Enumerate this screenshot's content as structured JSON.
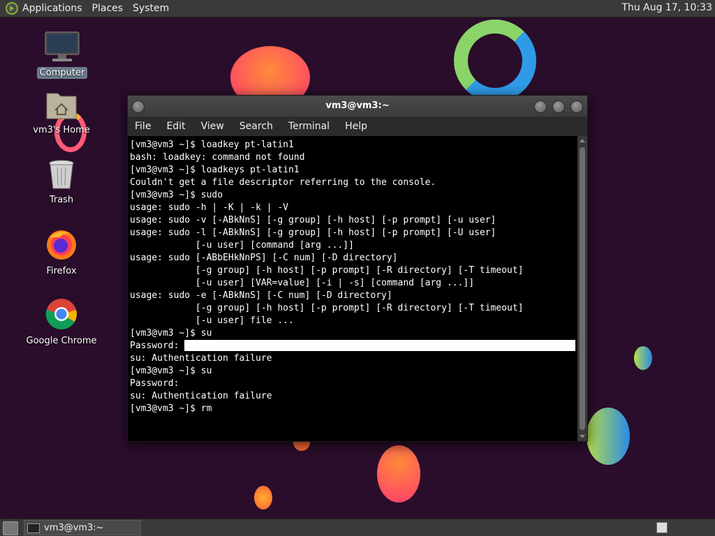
{
  "top_panel": {
    "menus": [
      "Applications",
      "Places",
      "System"
    ],
    "clock": "Thu Aug 17, 10:33"
  },
  "desktop_icons": [
    {
      "label": "Computer",
      "icon": "computer-icon"
    },
    {
      "label": "vm3's Home",
      "icon": "home-folder-icon"
    },
    {
      "label": "Trash",
      "icon": "trash-icon"
    },
    {
      "label": "Firefox",
      "icon": "firefox-icon"
    },
    {
      "label": "Google Chrome",
      "icon": "chrome-icon"
    }
  ],
  "window": {
    "title": "vm3@vm3:~",
    "menus": [
      "File",
      "Edit",
      "View",
      "Search",
      "Terminal",
      "Help"
    ]
  },
  "terminal": {
    "lines_before_password": "[vm3@vm3 ~]$ loadkey pt-latin1\nbash: loadkey: command not found\n[vm3@vm3 ~]$ loadkeys pt-latin1\nCouldn't get a file descriptor referring to the console.\n[vm3@vm3 ~]$ sudo\nusage: sudo -h | -K | -k | -V\nusage: sudo -v [-ABkNnS] [-g group] [-h host] [-p prompt] [-u user]\nusage: sudo -l [-ABkNnS] [-g group] [-h host] [-p prompt] [-U user]\n            [-u user] [command [arg ...]]\nusage: sudo [-ABbEHkNnPS] [-C num] [-D directory]\n            [-g group] [-h host] [-p prompt] [-R directory] [-T timeout]\n            [-u user] [VAR=value] [-i | -s] [command [arg ...]]\nusage: sudo -e [-ABkNnS] [-C num] [-D directory]\n            [-g group] [-h host] [-p prompt] [-R directory] [-T timeout]\n            [-u user] file ...\n[vm3@vm3 ~]$ su",
    "password_prompt": "Password: ",
    "lines_after_password": "su: Authentication failure\n[vm3@vm3 ~]$ su\nPassword:\nsu: Authentication failure\n[vm3@vm3 ~]$ rm"
  },
  "taskbar": {
    "task_label": "vm3@vm3:~"
  }
}
